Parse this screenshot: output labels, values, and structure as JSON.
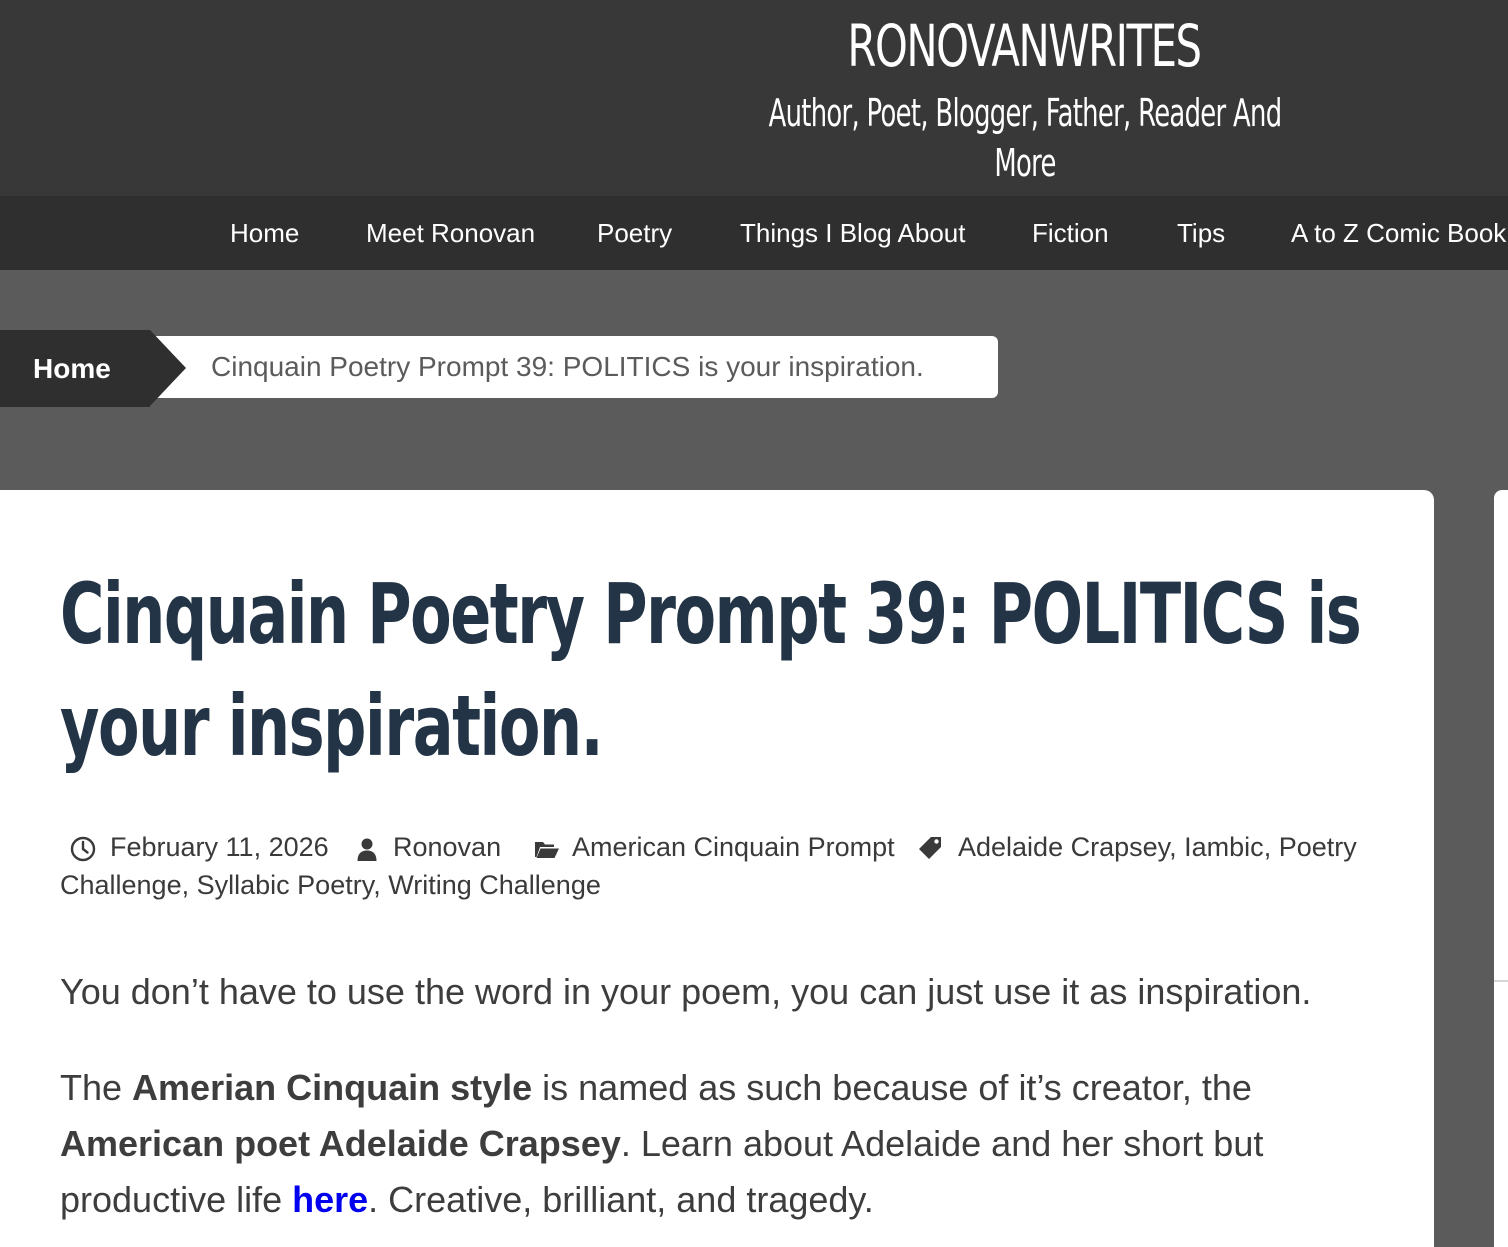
{
  "header": {
    "site_title": "RONOVANWRITES",
    "tagline": "Author, Poet, Blogger, Father, Reader And More"
  },
  "nav": {
    "items": [
      {
        "label": "Home"
      },
      {
        "label": "Meet Ronovan"
      },
      {
        "label": "Poetry"
      },
      {
        "label": "Things I Blog About"
      },
      {
        "label": "Fiction"
      },
      {
        "label": "Tips"
      },
      {
        "label": "A to Z Comic Book"
      }
    ]
  },
  "breadcrumb": {
    "home": "Home",
    "current": "Cinquain Poetry Prompt 39: POLITICS is your inspiration."
  },
  "post": {
    "title_line1": "Cinquain Poetry Prompt 39: POLITICS is",
    "title_line2": "your inspiration.",
    "meta": {
      "date": "February 11, 2026",
      "author": "Ronovan",
      "category": "American Cinquain Prompt",
      "tags": [
        "Adelaide Crapsey",
        "Iambic",
        "Poetry Challenge",
        "Syllabic Poetry",
        "Writing Challenge"
      ],
      "tag_sep": ",",
      "tag_poetry_part1": "Poetry",
      "tag_poetry_part2": "Challenge"
    },
    "para1": "You don’t have to use the word in your poem, you can just use it as inspiration.",
    "para2": {
      "t1": "The ",
      "b1": "Amerian Cinquain style",
      "t2": " is named as such because of it’s creator, the",
      "b2": "American poet  Adelaide Crapsey",
      "t3": ". Learn about Adelaide and her short but",
      "t4": "productive life ",
      "link": "here",
      "t5": ". Creative, brilliant, and tragedy."
    }
  },
  "colors": {
    "header_bg": "#383838",
    "nav_bg": "#2f2f2f",
    "page_bg": "#5b5b5b",
    "title_color": "#233446",
    "link_color": "#0000ee"
  },
  "icons": {
    "date": "clock-icon",
    "author": "user-icon",
    "category": "folder-open-icon",
    "tags": "tag-icon"
  }
}
